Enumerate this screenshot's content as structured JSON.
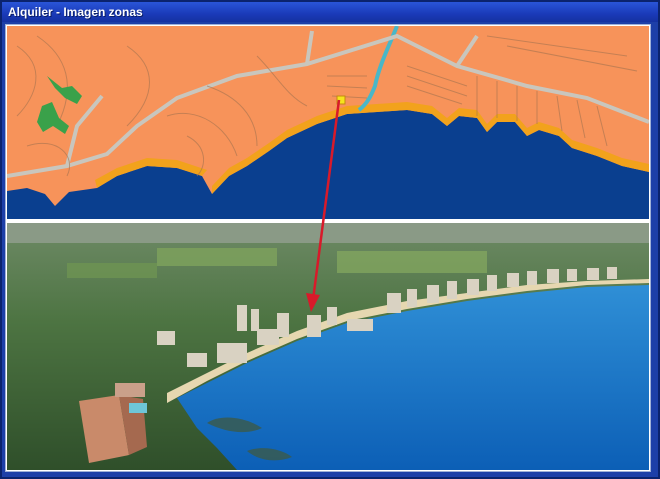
{
  "window": {
    "title": "Alquiler - Imagen zonas"
  },
  "images": {
    "map": {
      "content": "street-map-coastline"
    },
    "photo": {
      "content": "aerial-photo-beach"
    },
    "arrow": {
      "color": "#d81a2a"
    }
  },
  "colors": {
    "land": "#f7935a",
    "sea": "#0a3f8f",
    "beach": "#f2a21c",
    "roads": "#c9c6bd",
    "titlebar": "#1f45c4"
  }
}
